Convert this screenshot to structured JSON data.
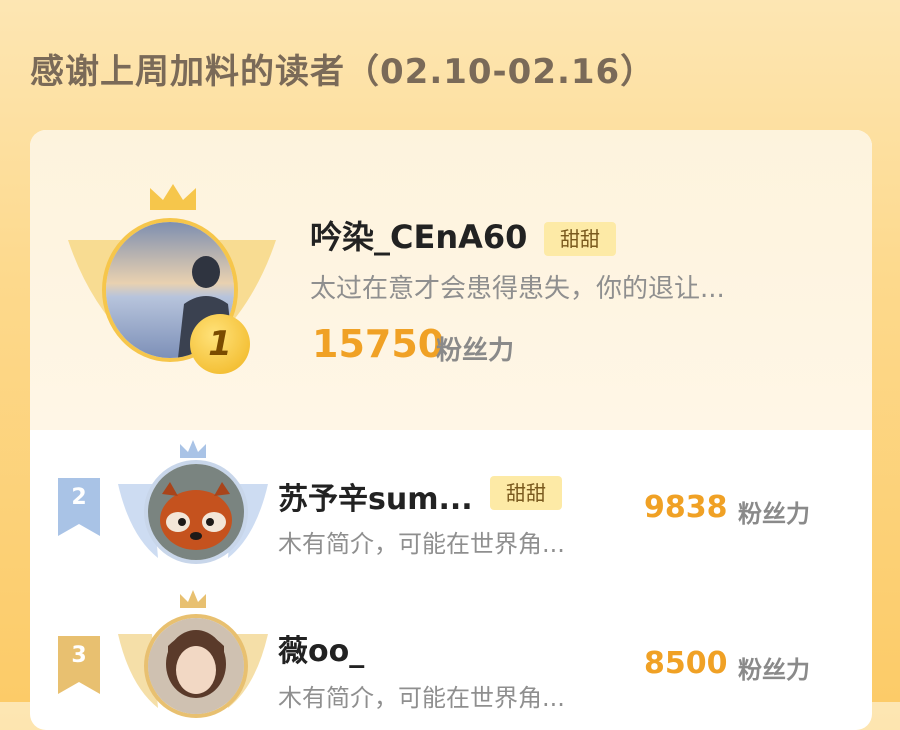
{
  "header": {
    "title": "感谢上周加料的读者（02.10-02.16）"
  },
  "leaderboard": [
    {
      "rank": "1",
      "name": "吟染_CEnA60",
      "badge": "甜甜",
      "bio": "太过在意才会患得患失，你的退让...",
      "score": "15750",
      "unit": "粉丝力"
    },
    {
      "rank": "2",
      "name": "苏予辛sum...",
      "badge": "甜甜",
      "bio": "木有简介，可能在世界角...",
      "score": "9838",
      "unit": "粉丝力"
    },
    {
      "rank": "3",
      "name": "薇oo_",
      "badge": "",
      "bio": "木有简介，可能在世界角...",
      "score": "8500",
      "unit": "粉丝力"
    }
  ],
  "colors": {
    "gold": "#f0a125",
    "silver_blue": "#a9c3e6",
    "bronze": "#e8c070"
  }
}
